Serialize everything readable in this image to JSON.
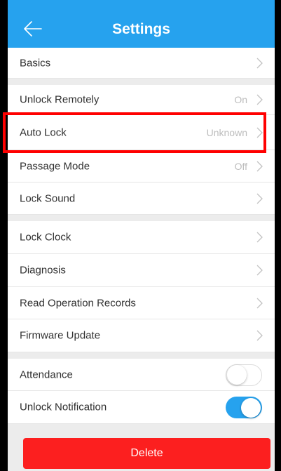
{
  "header": {
    "title": "Settings"
  },
  "rows": [
    {
      "label": "Basics",
      "value": ""
    },
    {
      "label": "Unlock Remotely",
      "value": "On"
    },
    {
      "label": "Auto Lock",
      "value": "Unknown"
    },
    {
      "label": "Passage Mode",
      "value": "Off"
    },
    {
      "label": "Lock Sound",
      "value": ""
    },
    {
      "label": "Lock Clock",
      "value": ""
    },
    {
      "label": "Diagnosis",
      "value": ""
    },
    {
      "label": "Read Operation Records",
      "value": ""
    },
    {
      "label": "Firmware Update",
      "value": ""
    },
    {
      "label": "Attendance",
      "toggle": "off"
    },
    {
      "label": "Unlock Notification",
      "toggle": "on"
    }
  ],
  "delete_label": "Delete",
  "colors": {
    "accent": "#26a2ee",
    "delete": "#fc1f1f",
    "highlight": "#ff0000"
  }
}
